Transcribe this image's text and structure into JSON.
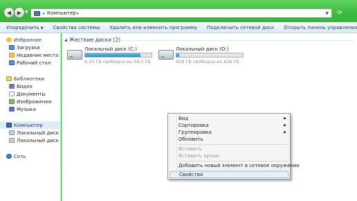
{
  "address_bar": {
    "crumb": "Компьютер",
    "back_icon": "back-arrow-icon",
    "forward_icon": "forward-arrow-icon",
    "refresh_icon": "refresh-icon"
  },
  "toolbar": {
    "items": [
      "Упорядочить",
      "Свойства системы",
      "Удалить или изменить программу",
      "Подключить сетевой диск",
      "Открыть панель управления"
    ]
  },
  "sidebar": {
    "favorites": {
      "title": "Избранное",
      "items": [
        "Загрузки",
        "Недавние места",
        "Рабочий стол"
      ]
    },
    "libraries": {
      "title": "Библиотеки",
      "items": [
        "Видео",
        "Документы",
        "Изображения",
        "Музыка"
      ]
    },
    "computer": {
      "title": "Компьютер",
      "items": [
        "Локальный диск (C:)",
        "Локальный диск (D:)"
      ]
    },
    "network": {
      "title": "Сеть"
    }
  },
  "content": {
    "group_title": "Жесткие диски (2)",
    "drives": [
      {
        "name": "Локальный диск (C:)",
        "free_text": "6,50 ГБ свободно из 39,1 ГБ",
        "used_fraction": 0.83
      },
      {
        "name": "Локальный диск (D:)",
        "free_text": "409 ГБ свободно из 426 ГБ",
        "used_fraction": 0.04
      }
    ]
  },
  "context_menu": {
    "view": "Вид",
    "sort": "Сортировка",
    "group": "Группировка",
    "refresh": "Обновить",
    "paste": "Вставить",
    "paste_shortcut": "Вставить ярлык",
    "add_network": "Добавить новый элемент в сетевое окружение",
    "properties": "Свойства"
  },
  "colors": {
    "desktop_accent": "#2fb02f",
    "drive_bar_fill": "#1f8fd0",
    "group_header": "#1e3287"
  }
}
